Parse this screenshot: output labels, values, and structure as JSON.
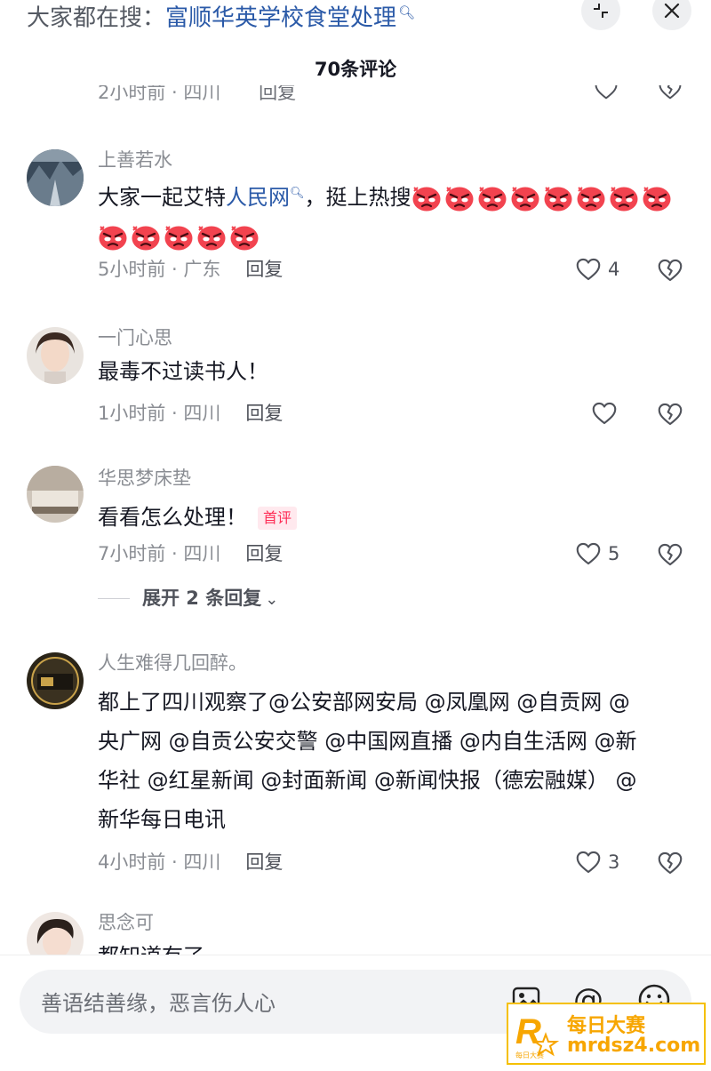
{
  "header": {
    "search_prefix": "大家都在搜：",
    "search_query": "富顺华英学校食堂处理",
    "collapse_icon": "collapse-icon",
    "close_icon": "close-icon"
  },
  "comment_count": "70条评论",
  "partial_top": {
    "time_location": "2小时前 · 四川",
    "reply_label": "回复"
  },
  "comments": [
    {
      "username": "上善若水",
      "text_before_link": "大家一起艾特",
      "link_text": "人民网",
      "text_after_link": "，挺上热搜",
      "emoji": "angry-face",
      "emoji_count": 13,
      "time_location": "5小时前 · 广东",
      "reply_label": "回复",
      "likes": "4"
    },
    {
      "username": "一门心思",
      "text": "最毒不过读书人！",
      "time_location": "1小时前 · 四川",
      "reply_label": "回复",
      "likes": ""
    },
    {
      "username": "华思梦床垫",
      "text": "看看怎么处理！",
      "badge": "首评",
      "time_location": "7小时前 · 四川",
      "reply_label": "回复",
      "likes": "5",
      "expand_replies": "展开 2 条回复"
    },
    {
      "username": "人生难得几回醉。",
      "text_lines": [
        "都上了四川观察了@公安部网安局 @凤凰网 @自贡网 @",
        "央广网 @自贡公安交警 @中国网直播 @内自生活网 @新",
        "华社 @红星新闻 @封面新闻 @新闻快报（德宏融媒） @",
        "新华每日电讯"
      ],
      "time_location": "4小时前 · 四川",
      "reply_label": "回复",
      "likes": "3"
    },
    {
      "username": "思念可",
      "text": "都知道有了"
    }
  ],
  "input": {
    "placeholder": "善语结善缘，恶言伤人心",
    "image_icon": "image-icon",
    "at_icon": "at-icon",
    "emoji_icon": "emoji-icon"
  },
  "watermark": {
    "title": "每日大赛",
    "domain": "mrdsz4.com",
    "logo_letter": "R",
    "logo_caption": "每日大赛"
  },
  "colors": {
    "link": "#2b5aa8",
    "meta": "#8a8d93",
    "badge": "#fe2c55",
    "watermark": "#f7a600"
  }
}
